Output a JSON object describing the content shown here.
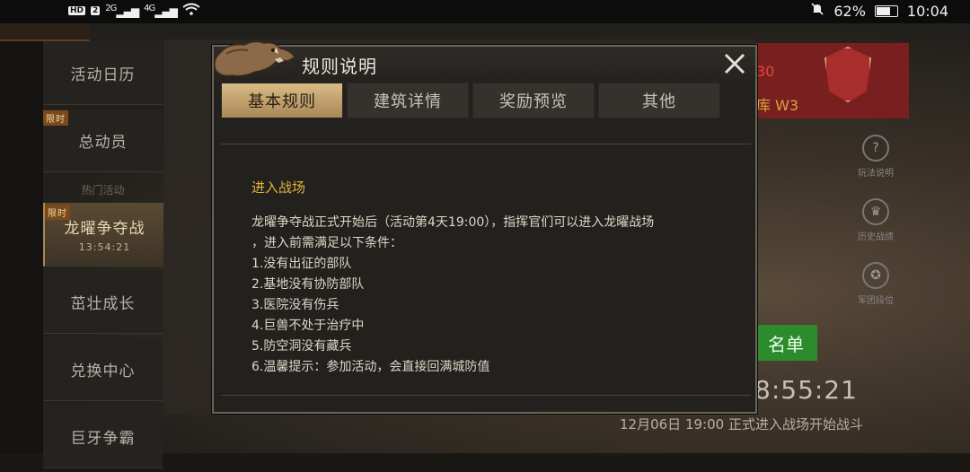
{
  "status_bar": {
    "hd": "HD",
    "sim": "2",
    "net1": "2G",
    "net2": "4G",
    "battery": "62%",
    "time": "10:04"
  },
  "side_menu": {
    "items": [
      {
        "label": "活动日历",
        "tag": "",
        "sub": ""
      },
      {
        "label": "总动员",
        "tag": "限时",
        "sub": ""
      },
      {
        "label": "龙曜争夺战",
        "tag": "限时",
        "sub": "13:54:21"
      },
      {
        "label": "茁壮成长",
        "tag": "",
        "sub": ""
      },
      {
        "label": "兑换中心",
        "tag": "",
        "sub": ""
      },
      {
        "label": "巨牙争霸",
        "tag": "",
        "sub": ""
      }
    ],
    "separator": "热门活动"
  },
  "background": {
    "top_right_1": "30",
    "top_right_2": "库 W3",
    "icons": [
      {
        "icon": "help-icon",
        "label": "玩法说明"
      },
      {
        "icon": "trophy-icon",
        "label": "历史战绩"
      },
      {
        "icon": "rank-icon",
        "label": "军团段位"
      }
    ],
    "green_button": "名单",
    "timer": "8:55:21",
    "bottom_text": "12月06日 19:00 正式进入战场开始战斗"
  },
  "dialog": {
    "title": "规则说明",
    "tabs": [
      "基本规则",
      "建筑详情",
      "奖励预览",
      "其他"
    ],
    "active_tab": 0,
    "section_title": "进入战场",
    "intro_line1": "龙曜争夺战正式开始后（活动第4天19:00），指挥官们可以进入龙曜战场",
    "intro_line2": "，进入前需满足以下条件：",
    "rules": [
      "1.没有出征的部队",
      "2.基地没有协防部队",
      "3.医院没有伤兵",
      "4.巨兽不处于治疗中",
      "5.防空洞没有藏兵",
      "6.温馨提示：参加活动，会直接回满城防值"
    ]
  }
}
